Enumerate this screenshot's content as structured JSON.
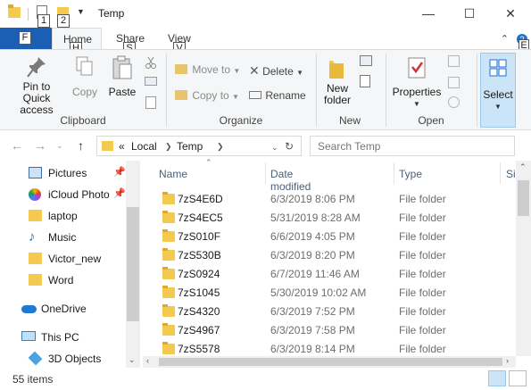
{
  "window": {
    "title": "Temp",
    "qat_keytips": [
      "1",
      "2"
    ]
  },
  "ribbon_tabs": {
    "file": {
      "label": "F"
    },
    "home": {
      "label": "Home",
      "keytip": "H"
    },
    "share": {
      "label": "Share",
      "keytip": "S"
    },
    "view": {
      "label": "View",
      "keytip": "V"
    },
    "help_keytip": "E"
  },
  "clipboard": {
    "pin_to_quick_access": "Pin to Quick access",
    "copy": "Copy",
    "paste": "Paste",
    "group": "Clipboard"
  },
  "organize": {
    "move_to": "Move to",
    "copy_to": "Copy to",
    "delete": "Delete",
    "rename": "Rename",
    "group": "Organize"
  },
  "new": {
    "new_folder": "New folder",
    "group": "New"
  },
  "open": {
    "properties": "Properties",
    "group": "Open"
  },
  "select": {
    "label": "Select"
  },
  "address": {
    "prefix": "«",
    "segments": [
      "Local",
      "Temp"
    ],
    "search_placeholder": "Search Temp"
  },
  "nav_pane": [
    {
      "label": "Pictures",
      "icon": "pictures-icon",
      "pinned": true
    },
    {
      "label": "iCloud Photo",
      "icon": "icloud-photos-icon",
      "pinned": true
    },
    {
      "label": "laptop",
      "icon": "folder-icon",
      "pinned": false
    },
    {
      "label": "Music",
      "icon": "music-icon",
      "pinned": false
    },
    {
      "label": "Victor_new",
      "icon": "folder-icon",
      "pinned": false
    },
    {
      "label": "Word",
      "icon": "folder-icon",
      "pinned": false
    },
    {
      "label": "OneDrive",
      "icon": "onedrive-icon",
      "pinned": false
    },
    {
      "label": "This PC",
      "icon": "this-pc-icon",
      "pinned": false
    },
    {
      "label": "3D Objects",
      "icon": "3d-objects-icon",
      "pinned": false
    }
  ],
  "columns": {
    "name": "Name",
    "date": "Date modified",
    "type": "Type",
    "size": "Si"
  },
  "files": [
    {
      "name": "7zS4E6D",
      "date": "6/3/2019 8:06 PM",
      "type": "File folder"
    },
    {
      "name": "7zS4EC5",
      "date": "5/31/2019 8:28 AM",
      "type": "File folder"
    },
    {
      "name": "7zS010F",
      "date": "6/6/2019 4:05 PM",
      "type": "File folder"
    },
    {
      "name": "7zS530B",
      "date": "6/3/2019 8:20 PM",
      "type": "File folder"
    },
    {
      "name": "7zS0924",
      "date": "6/7/2019 11:46 AM",
      "type": "File folder"
    },
    {
      "name": "7zS1045",
      "date": "5/30/2019 10:02 AM",
      "type": "File folder"
    },
    {
      "name": "7zS4320",
      "date": "6/3/2019 7:52 PM",
      "type": "File folder"
    },
    {
      "name": "7zS4967",
      "date": "6/3/2019 7:58 PM",
      "type": "File folder"
    },
    {
      "name": "7zS5578",
      "date": "6/3/2019 8:14 PM",
      "type": "File folder"
    }
  ],
  "status": {
    "item_count": "55 items"
  }
}
